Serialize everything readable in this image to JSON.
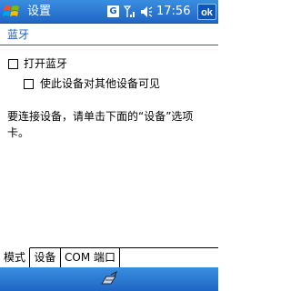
{
  "titlebar": {
    "title": "设置",
    "badge": "G",
    "time": "17:56",
    "ok_label": "ok"
  },
  "header": {
    "title": "蓝牙"
  },
  "options": {
    "turn_on_bluetooth": {
      "label": "打开蓝牙",
      "checked": false
    },
    "make_visible": {
      "label": "使此设备对其他设备可见",
      "checked": false
    }
  },
  "info_text": "要连接设备，请单击下面的“设备”选项卡。",
  "tabs": [
    {
      "label": "模式",
      "active": true
    },
    {
      "label": "设备",
      "active": false
    },
    {
      "label": "COM 端口",
      "active": false
    }
  ],
  "icons": {
    "start": "windows-flag-icon",
    "signal": "signal-strength-icon",
    "volume": "speaker-icon",
    "keyboard": "keyboard-icon"
  },
  "colors": {
    "titlebar": "#1f66c4",
    "header_text": "#1a5fc4"
  }
}
